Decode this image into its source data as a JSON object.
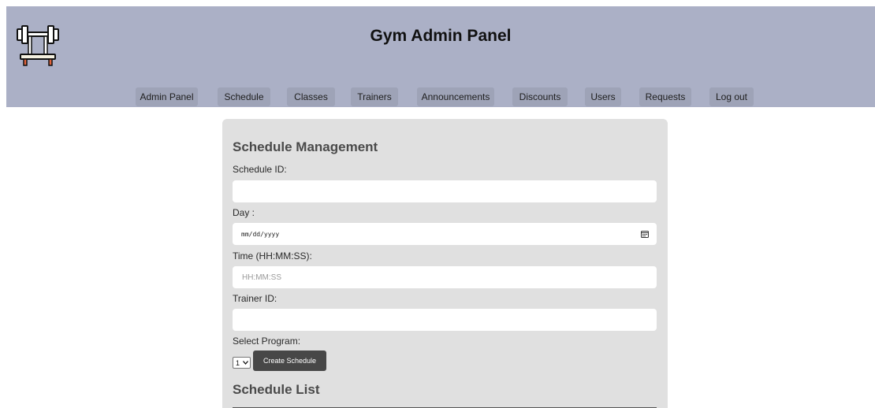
{
  "header": {
    "title": "Gym Admin Panel",
    "logo_icon": "barbell-bench-icon"
  },
  "nav": {
    "items": [
      {
        "label": "Admin Panel"
      },
      {
        "label": "Schedule"
      },
      {
        "label": "Classes"
      },
      {
        "label": "Trainers"
      },
      {
        "label": "Announcements"
      },
      {
        "label": "Discounts"
      },
      {
        "label": "Users"
      },
      {
        "label": "Requests"
      },
      {
        "label": "Log out"
      }
    ]
  },
  "form": {
    "heading": "Schedule Management",
    "schedule_id_label": "Schedule ID:",
    "schedule_id_value": "",
    "day_label": "Day :",
    "day_placeholder": "mm/dd/yyyy",
    "time_label": "Time (HH:MM:SS):",
    "time_placeholder": "HH:MM:SS",
    "trainer_id_label": "Trainer ID:",
    "trainer_id_value": "",
    "program_label": "Select Program:",
    "program_selected": "1",
    "submit_label": "Create Schedule"
  },
  "list": {
    "heading": "Schedule List"
  },
  "colors": {
    "header_bg": "#abb0c6",
    "nav_button_bg": "#9ea3b7",
    "panel_bg": "#e0e0e0",
    "primary_button_bg": "#474747"
  }
}
